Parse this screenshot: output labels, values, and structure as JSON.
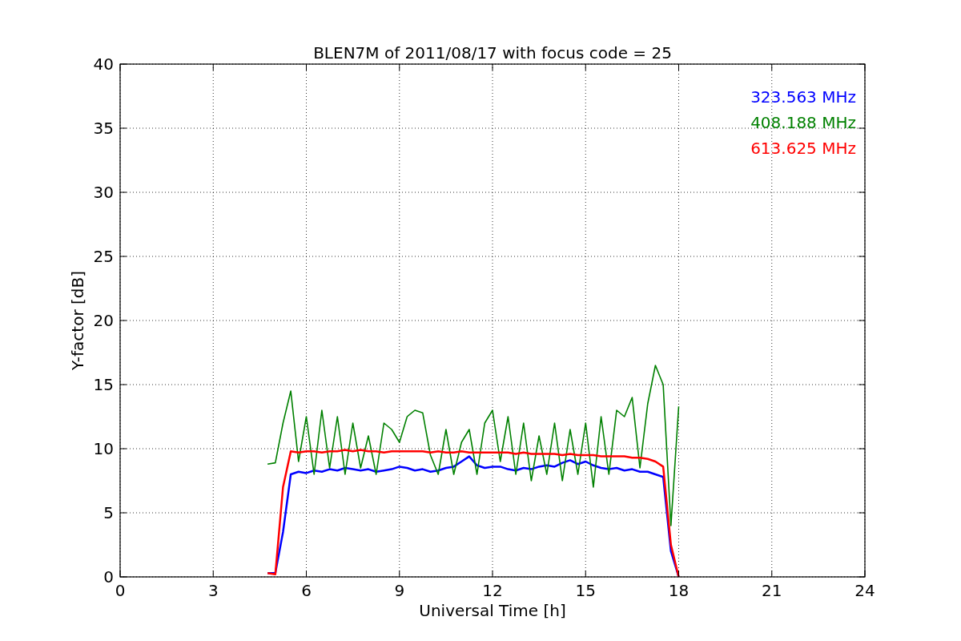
{
  "chart_data": {
    "type": "line",
    "title": "BLEN7M of 2011/08/17 with focus code = 25",
    "xlabel": "Universal Time [h]",
    "ylabel": "Y-factor [dB]",
    "x": [
      4.75,
      5,
      5.25,
      5.5,
      5.75,
      6,
      6.25,
      6.5,
      6.75,
      7,
      7.25,
      7.5,
      7.75,
      8,
      8.25,
      8.5,
      8.75,
      9,
      9.25,
      9.5,
      9.75,
      10,
      10.25,
      10.5,
      10.75,
      11,
      11.25,
      11.5,
      11.75,
      12,
      12.25,
      12.5,
      12.75,
      13,
      13.25,
      13.5,
      13.75,
      14,
      14.25,
      14.5,
      14.75,
      15,
      15.25,
      15.5,
      15.75,
      16,
      16.25,
      16.5,
      16.75,
      17,
      17.25,
      17.5,
      17.75,
      18
    ],
    "series": [
      {
        "name": "323.563 MHz",
        "color": "#0000ff",
        "values": [
          0.3,
          0.3,
          3.5,
          8.0,
          8.2,
          8.1,
          8.3,
          8.2,
          8.4,
          8.3,
          8.5,
          8.4,
          8.3,
          8.4,
          8.2,
          8.3,
          8.4,
          8.6,
          8.5,
          8.3,
          8.4,
          8.2,
          8.3,
          8.5,
          8.6,
          9.0,
          9.4,
          8.7,
          8.5,
          8.6,
          8.6,
          8.4,
          8.3,
          8.5,
          8.4,
          8.6,
          8.7,
          8.6,
          8.9,
          9.1,
          8.8,
          9.0,
          8.7,
          8.5,
          8.4,
          8.5,
          8.3,
          8.4,
          8.2,
          8.2,
          8.0,
          7.8,
          2.0,
          0.0
        ]
      },
      {
        "name": "408.188 MHz",
        "color": "#008000",
        "values": [
          8.8,
          8.9,
          12.0,
          14.5,
          9.0,
          12.5,
          8.0,
          13.0,
          8.5,
          12.5,
          8.0,
          12.0,
          8.5,
          11.0,
          8.0,
          12.0,
          11.5,
          10.5,
          12.5,
          13.0,
          12.8,
          9.5,
          8.0,
          11.5,
          8.0,
          10.5,
          11.5,
          8.0,
          12.0,
          13.0,
          9.0,
          12.5,
          8.0,
          12.0,
          7.5,
          11.0,
          8.0,
          12.0,
          7.5,
          11.5,
          8.0,
          12.0,
          7.0,
          12.5,
          8.0,
          13.0,
          12.5,
          14.0,
          8.5,
          13.5,
          16.5,
          15.0,
          4.0,
          13.3
        ]
      },
      {
        "name": "613.625 MHz",
        "color": "#ff0000",
        "values": [
          0.3,
          0.2,
          7.0,
          9.8,
          9.7,
          9.8,
          9.8,
          9.7,
          9.8,
          9.8,
          9.9,
          9.8,
          9.9,
          9.8,
          9.8,
          9.7,
          9.8,
          9.8,
          9.8,
          9.8,
          9.8,
          9.7,
          9.8,
          9.7,
          9.7,
          9.8,
          9.7,
          9.7,
          9.7,
          9.7,
          9.7,
          9.7,
          9.6,
          9.7,
          9.6,
          9.6,
          9.6,
          9.6,
          9.5,
          9.6,
          9.5,
          9.5,
          9.5,
          9.4,
          9.4,
          9.4,
          9.4,
          9.3,
          9.3,
          9.2,
          9.0,
          8.6,
          2.5,
          0.0
        ]
      }
    ],
    "xlim": [
      0,
      24
    ],
    "ylim": [
      0,
      40
    ],
    "grid": true,
    "xticks": [
      0,
      3,
      6,
      9,
      12,
      15,
      18,
      21,
      24
    ],
    "yticks": [
      0,
      5,
      10,
      15,
      20,
      25,
      30,
      35,
      40
    ]
  }
}
